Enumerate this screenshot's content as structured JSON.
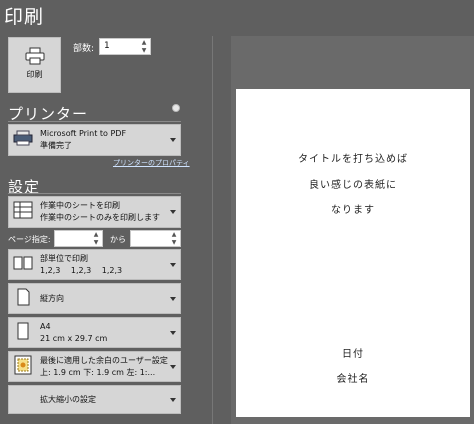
{
  "title": "印刷",
  "print_button": {
    "label": "印刷"
  },
  "copies": {
    "label": "部数:",
    "value": "1"
  },
  "printer": {
    "heading": "プリンター",
    "name": "Microsoft Print to PDF",
    "status": "準備完了",
    "properties_link": "プリンターのプロパティ"
  },
  "settings": {
    "heading": "設定",
    "scope": {
      "line1": "作業中のシートを印刷",
      "line2": "作業中のシートのみを印刷します"
    },
    "pages": {
      "label": "ページ指定:",
      "to": "から"
    },
    "collate": {
      "line1": "部単位で印刷",
      "line2": "1,2,3　 1,2,3　 1,2,3"
    },
    "orientation": {
      "line1": "縦方向"
    },
    "paper": {
      "line1": "A4",
      "line2": "21 cm x 29.7 cm"
    },
    "margins": {
      "line1": "最後に適用した余白のユーザー設定",
      "line2": "上: 1.9 cm 下: 1.9 cm 左: 1:..."
    },
    "scaling": {
      "line1": "拡大縮小の設定"
    }
  },
  "preview": {
    "line1": "タイトルを打ち込めば",
    "line2": "良い感じの表紙に",
    "line3": "なります",
    "date": "日付",
    "company": "会社名"
  }
}
